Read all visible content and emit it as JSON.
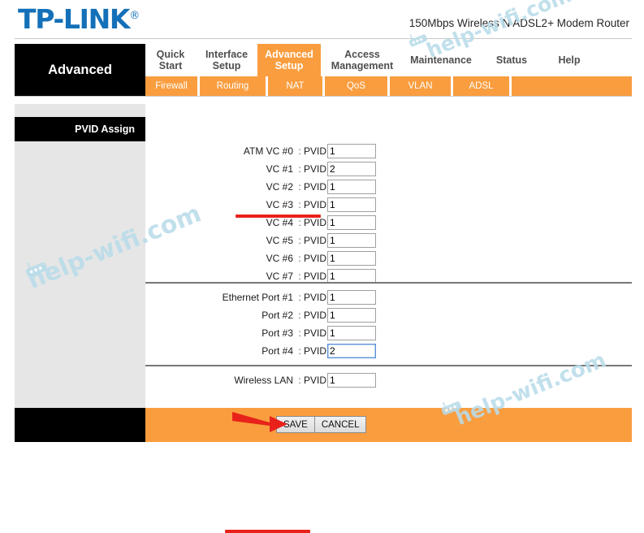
{
  "header": {
    "logo_text": "TP-LINK",
    "logo_trademark": "®",
    "model_name": "150Mbps Wireless N ADSL2+ Modem Router",
    "logo_color": "#1470b8"
  },
  "nav": {
    "brand_label": "Advanced",
    "accent_color": "#f99d3f",
    "tabs": [
      {
        "label": "Quick\nStart",
        "active": false
      },
      {
        "label": "Interface\nSetup",
        "active": false
      },
      {
        "label": "Advanced\nSetup",
        "active": true
      },
      {
        "label": "Access\nManagement",
        "active": false
      },
      {
        "label": "Maintenance",
        "active": false
      },
      {
        "label": "Status",
        "active": false
      },
      {
        "label": "Help",
        "active": false
      }
    ],
    "subtabs": [
      {
        "label": "Firewall"
      },
      {
        "label": "Routing"
      },
      {
        "label": "NAT"
      },
      {
        "label": "QoS"
      },
      {
        "label": "VLAN"
      },
      {
        "label": "ADSL"
      },
      {
        "label": ""
      }
    ]
  },
  "sidebar": {
    "section_title": "PVID Assign"
  },
  "form": {
    "pvid_label": "PVID",
    "colon": ":",
    "atm_rows": [
      {
        "label": "ATM VC #0",
        "value": "1",
        "focused": false
      },
      {
        "label": "VC #1",
        "value": "2",
        "focused": false
      },
      {
        "label": "VC #2",
        "value": "1",
        "focused": false
      },
      {
        "label": "VC #3",
        "value": "1",
        "focused": false
      },
      {
        "label": "VC #4",
        "value": "1",
        "focused": false
      },
      {
        "label": "VC #5",
        "value": "1",
        "focused": false
      },
      {
        "label": "VC #6",
        "value": "1",
        "focused": false
      },
      {
        "label": "VC #7",
        "value": "1",
        "focused": false
      }
    ],
    "ethernet_rows": [
      {
        "label": "Ethernet Port #1",
        "value": "1",
        "focused": false
      },
      {
        "label": "Port #2",
        "value": "1",
        "focused": false
      },
      {
        "label": "Port #3",
        "value": "1",
        "focused": false
      },
      {
        "label": "Port #4",
        "value": "2",
        "focused": true
      }
    ],
    "wireless_rows": [
      {
        "label": "Wireless LAN",
        "value": "1",
        "focused": false
      }
    ]
  },
  "footer": {
    "save_label": "SAVE",
    "cancel_label": "CANCEL"
  },
  "annotations": {
    "arrow_color": "#e8221b",
    "underline_color": "#e8221b",
    "underline_targets": [
      "VC #1",
      "Port #4"
    ],
    "arrow_target": "SAVE"
  },
  "watermark": {
    "text": "help-wifi.com",
    "color": "#b9dcea"
  }
}
